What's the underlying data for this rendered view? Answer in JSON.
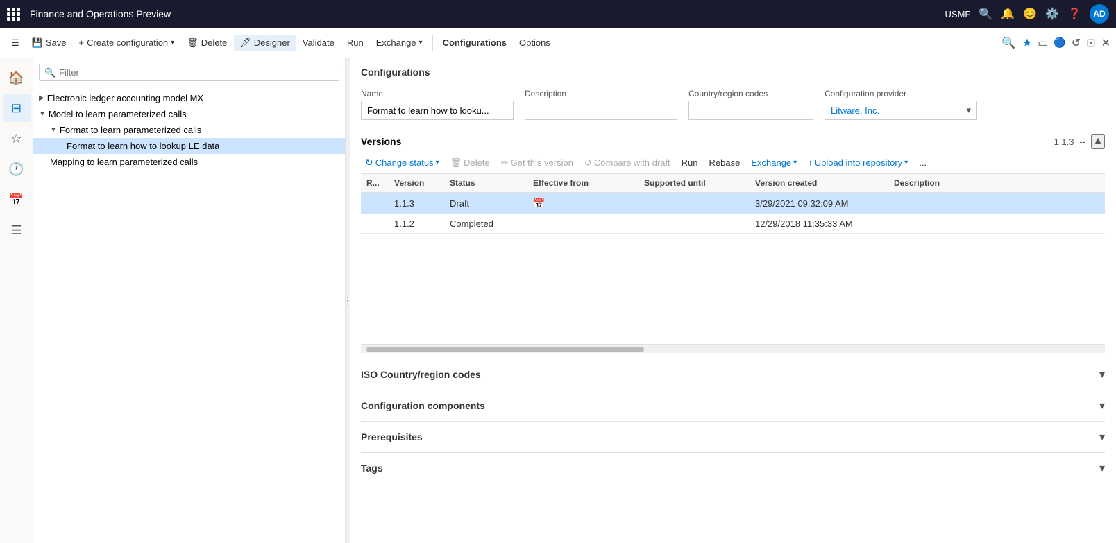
{
  "titlebar": {
    "app_name": "Finance and Operations Preview",
    "user": "USMF",
    "avatar": "AD"
  },
  "toolbar": {
    "save_label": "Save",
    "create_label": "Create configuration",
    "delete_label": "Delete",
    "designer_label": "Designer",
    "validate_label": "Validate",
    "run_label": "Run",
    "exchange_label": "Exchange",
    "configurations_label": "Configurations",
    "options_label": "Options"
  },
  "sidebar_icons": {
    "home": "🏠",
    "star": "☆",
    "recent": "🕐",
    "calendar": "📅",
    "list": "☰"
  },
  "tree": {
    "filter_placeholder": "Filter",
    "items": [
      {
        "id": "electronic-ledger",
        "label": "Electronic ledger accounting model MX",
        "level": 0,
        "expanded": false,
        "toggled": true
      },
      {
        "id": "model-parameterized",
        "label": "Model to learn parameterized calls",
        "level": 0,
        "expanded": true,
        "toggled": true
      },
      {
        "id": "format-parameterized",
        "label": "Format to learn parameterized calls",
        "level": 1,
        "expanded": true,
        "toggled": true
      },
      {
        "id": "format-lookup",
        "label": "Format to learn how to lookup LE data",
        "level": 2,
        "expanded": false,
        "selected": true
      },
      {
        "id": "mapping-parameterized",
        "label": "Mapping to learn parameterized calls",
        "level": 1,
        "expanded": false
      }
    ]
  },
  "content": {
    "title": "Configurations",
    "form": {
      "name_label": "Name",
      "name_value": "Format to learn how to looku...",
      "description_label": "Description",
      "description_value": "",
      "country_label": "Country/region codes",
      "country_value": "",
      "provider_label": "Configuration provider",
      "provider_value": "Litware, Inc."
    },
    "versions": {
      "title": "Versions",
      "version_display": "1.1.3",
      "separator": "--",
      "columns": {
        "r": "R...",
        "version": "Version",
        "status": "Status",
        "effective_from": "Effective from",
        "supported_until": "Supported until",
        "version_created": "Version created",
        "description": "Description"
      },
      "rows": [
        {
          "r": "",
          "version": "1.1.3",
          "status": "Draft",
          "effective_from": "",
          "supported_until": "",
          "version_created": "3/29/2021 09:32:09 AM",
          "description": "",
          "selected": true
        },
        {
          "r": "",
          "version": "1.1.2",
          "status": "Completed",
          "effective_from": "",
          "supported_until": "",
          "version_created": "12/29/2018 11:35:33 AM",
          "description": "",
          "selected": false
        }
      ],
      "toolbar": {
        "change_status": "Change status",
        "delete": "Delete",
        "get_version": "Get this version",
        "compare_draft": "Compare with draft",
        "run": "Run",
        "rebase": "Rebase",
        "exchange": "Exchange",
        "upload_repository": "Upload into repository",
        "more": "..."
      }
    },
    "sections": [
      {
        "id": "iso-country",
        "label": "ISO Country/region codes"
      },
      {
        "id": "config-components",
        "label": "Configuration components"
      },
      {
        "id": "prerequisites",
        "label": "Prerequisites"
      },
      {
        "id": "tags",
        "label": "Tags"
      }
    ]
  }
}
